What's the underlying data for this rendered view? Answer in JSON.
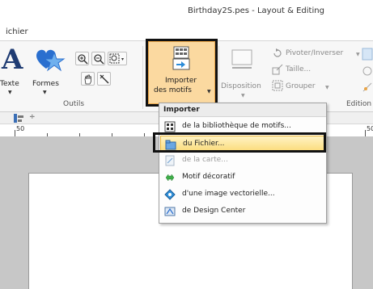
{
  "window": {
    "title": "Birthday2S.pes - Layout & Editing"
  },
  "tabs": {
    "file_tab": "ichier"
  },
  "ribbon": {
    "outils_group": {
      "label": "Outils",
      "texte_label": "Texte",
      "formes_label": "Formes"
    },
    "import": {
      "line1": "Importer",
      "line2": "des motifs"
    },
    "disposition": {
      "label": "Disposition",
      "pivoter": "Pivoter/Inverser",
      "taille": "Taille...",
      "grouper": "Grouper",
      "group_label": "Edition"
    }
  },
  "rulers": {
    "left_num": "50",
    "right_num": "50"
  },
  "subbar": {
    "symbol": "÷"
  },
  "dropdown": {
    "header": "Importer",
    "items": [
      {
        "label": "de la bibliothèque de motifs...",
        "icon": "library-grid-icon",
        "enabled": true
      },
      {
        "label": "du Fichier...",
        "icon": "folder-file-icon",
        "enabled": true,
        "highlighted": true
      },
      {
        "label": "de la carte...",
        "icon": "card-icon",
        "enabled": false
      },
      {
        "label": "Motif décoratif",
        "icon": "decorative-pattern-icon",
        "enabled": true
      },
      {
        "label": "d'une image vectorielle...",
        "icon": "vector-image-icon",
        "enabled": true
      },
      {
        "label": "de Design Center",
        "icon": "design-center-icon",
        "enabled": true
      }
    ]
  },
  "colors": {
    "accent_orange": "#e9a446",
    "highlight_yellow": "#fbdc7c",
    "title_blue": "#1f3c73"
  }
}
